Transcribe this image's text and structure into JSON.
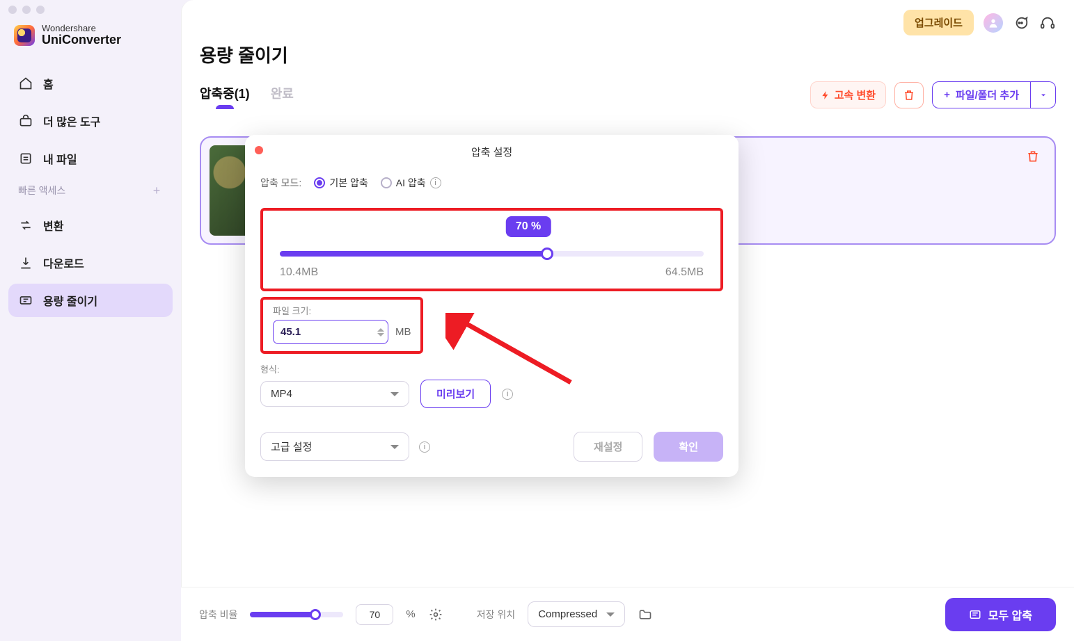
{
  "app": {
    "brand_top": "Wondershare",
    "brand_bottom": "UniConverter"
  },
  "sidebar": {
    "items": [
      {
        "label": "홈"
      },
      {
        "label": "더 많은 도구"
      },
      {
        "label": "내 파일"
      }
    ],
    "quick_header": "빠른 액세스",
    "quick_items": [
      {
        "label": "변환"
      },
      {
        "label": "다운로드"
      },
      {
        "label": "용량 줄이기"
      }
    ]
  },
  "topbar": {
    "upgrade": "업그레이드"
  },
  "page": {
    "title": "용량 줄이기"
  },
  "tabs": {
    "compressing": "압축중(1)",
    "done": "완료",
    "fast": "고속 변환",
    "add_file": "파일/폴더 추가"
  },
  "modal": {
    "title": "압축 설정",
    "mode_label": "압축 모드:",
    "mode_basic": "기본 압축",
    "mode_ai": "AI 압축",
    "slider_percent": "70 %",
    "slider_min": "10.4MB",
    "slider_max": "64.5MB",
    "filesize_label": "파일 크기:",
    "filesize_value": "45.1",
    "filesize_unit": "MB",
    "format_label": "형식:",
    "format_value": "MP4",
    "preview": "미리보기",
    "advanced": "고급 설정",
    "reset": "재설정",
    "confirm": "확인"
  },
  "footer": {
    "ratio_label": "압축 비율",
    "ratio_value": "70",
    "percent_sign": "%",
    "save_label": "저장 위치",
    "save_value": "Compressed",
    "compress_all": "모두 압축"
  }
}
